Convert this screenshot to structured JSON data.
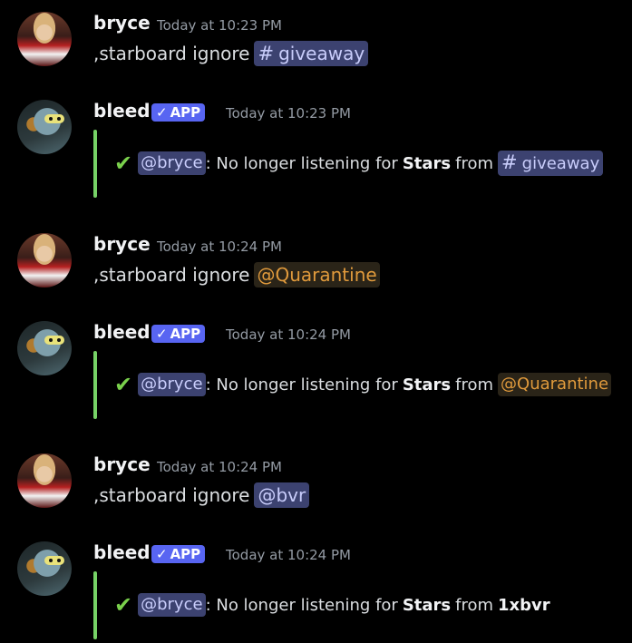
{
  "messages": [
    {
      "author": "bryce",
      "time": "Today at 10:23 PM",
      "prefix": ",starboard ignore",
      "target": "giveaway",
      "target_type": "channel"
    },
    {
      "author": "bleed",
      "badge": "APP",
      "time": "Today at 10:23 PM",
      "mention": "@bryce",
      "text1": ": No longer listening for",
      "bold": "Stars",
      "text2": "from",
      "target": "giveaway",
      "target_type": "channel"
    },
    {
      "author": "bryce",
      "time": "Today at 10:24 PM",
      "prefix": ",starboard ignore",
      "target": "@Quarantine",
      "target_type": "role"
    },
    {
      "author": "bleed",
      "badge": "APP",
      "time": "Today at 10:24 PM",
      "mention": "@bryce",
      "text1": ": No longer listening for",
      "bold": "Stars",
      "text2": "from",
      "target": "@Quarantine",
      "target_type": "role"
    },
    {
      "author": "bryce",
      "time": "Today at 10:24 PM",
      "prefix": ",starboard ignore",
      "target": "@bvr",
      "target_type": "user"
    },
    {
      "author": "bleed",
      "badge": "APP",
      "time": "Today at 10:24 PM",
      "mention": "@bryce",
      "text1": ": No longer listening for",
      "bold": "Stars",
      "text2": "from",
      "target": "1xbvr",
      "target_type": "plain"
    }
  ],
  "icons": {
    "check": "checkmark-icon",
    "channel": "hash-icon",
    "badge_check": "verified-check-icon"
  },
  "colors": {
    "embed_bar": "#76d266",
    "mention_bg": "#3c4270",
    "role_text": "#e09a3c",
    "badge": "#5865f2"
  }
}
